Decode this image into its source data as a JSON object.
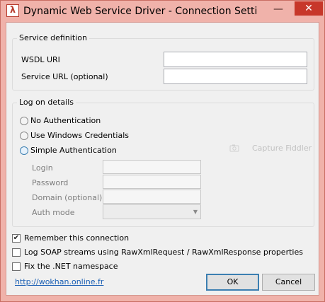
{
  "window": {
    "title": "Dynamic Web Service Driver - Connection Setti...",
    "icon_glyph": "λ",
    "minimize_glyph": "—",
    "close_glyph": "✕"
  },
  "service_definition": {
    "group_label": "Service definition",
    "wsdl_label": "WSDL URI",
    "wsdl_value": "",
    "service_url_label": "Service URL (optional)",
    "service_url_value": ""
  },
  "logon": {
    "group_label": "Log on details",
    "options": [
      {
        "label": "No Authentication",
        "selected": false
      },
      {
        "label": "Use Windows Credentials",
        "selected": false
      },
      {
        "label": "Simple Authentication",
        "selected": true
      }
    ],
    "capture_label": "Capture Fiddler",
    "fields": {
      "login_label": "Login",
      "password_label": "Password",
      "domain_label": "Domain (optional)",
      "auth_mode_label": "Auth mode",
      "login_value": "",
      "password_value": "",
      "domain_value": "",
      "auth_mode_value": ""
    }
  },
  "options": {
    "remember": {
      "label": "Remember this connection",
      "checked": true
    },
    "log_soap": {
      "label": "Log SOAP streams using RawXmlRequest / RawXmlResponse properties",
      "checked": false
    },
    "fix_ns": {
      "label": "Fix the .NET namespace",
      "checked": false
    }
  },
  "footer": {
    "link": "http://wokhan.online.fr",
    "ok_label": "OK",
    "cancel_label": "Cancel"
  },
  "colors": {
    "title_bar": "#f0b2aa",
    "close_button": "#c7372a",
    "accent": "#3c7fb1",
    "link": "#1a5fb4"
  }
}
